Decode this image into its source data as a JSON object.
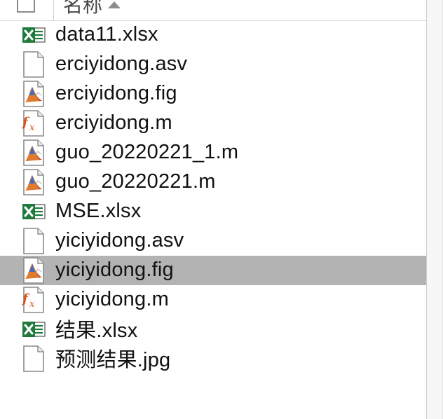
{
  "header": {
    "name_column": "名称",
    "sort_direction": "ascending"
  },
  "files": [
    {
      "name": "data11.xlsx",
      "icon": "excel-file-icon",
      "selected": false
    },
    {
      "name": "erciyidong.asv",
      "icon": "blank-file-icon",
      "selected": false
    },
    {
      "name": "erciyidong.fig",
      "icon": "matlab-figure-icon",
      "selected": false
    },
    {
      "name": "erciyidong.m",
      "icon": "matlab-script-icon",
      "selected": false
    },
    {
      "name": "guo_20220221_1.m",
      "icon": "matlab-figure-icon",
      "selected": false
    },
    {
      "name": "guo_20220221.m",
      "icon": "matlab-figure-icon",
      "selected": false
    },
    {
      "name": "MSE.xlsx",
      "icon": "excel-file-icon",
      "selected": false
    },
    {
      "name": "yiciyidong.asv",
      "icon": "blank-file-icon",
      "selected": false
    },
    {
      "name": "yiciyidong.fig",
      "icon": "matlab-figure-icon",
      "selected": true
    },
    {
      "name": "yiciyidong.m",
      "icon": "matlab-script-icon",
      "selected": false
    },
    {
      "name": "结果.xlsx",
      "icon": "excel-file-icon",
      "selected": false
    },
    {
      "name": "预测结果.jpg",
      "icon": "blank-file-icon",
      "selected": false
    }
  ],
  "colors": {
    "selection": "#b3b3b3",
    "excel_green": "#1f7a3c",
    "matlab_orange": "#d9531e"
  }
}
